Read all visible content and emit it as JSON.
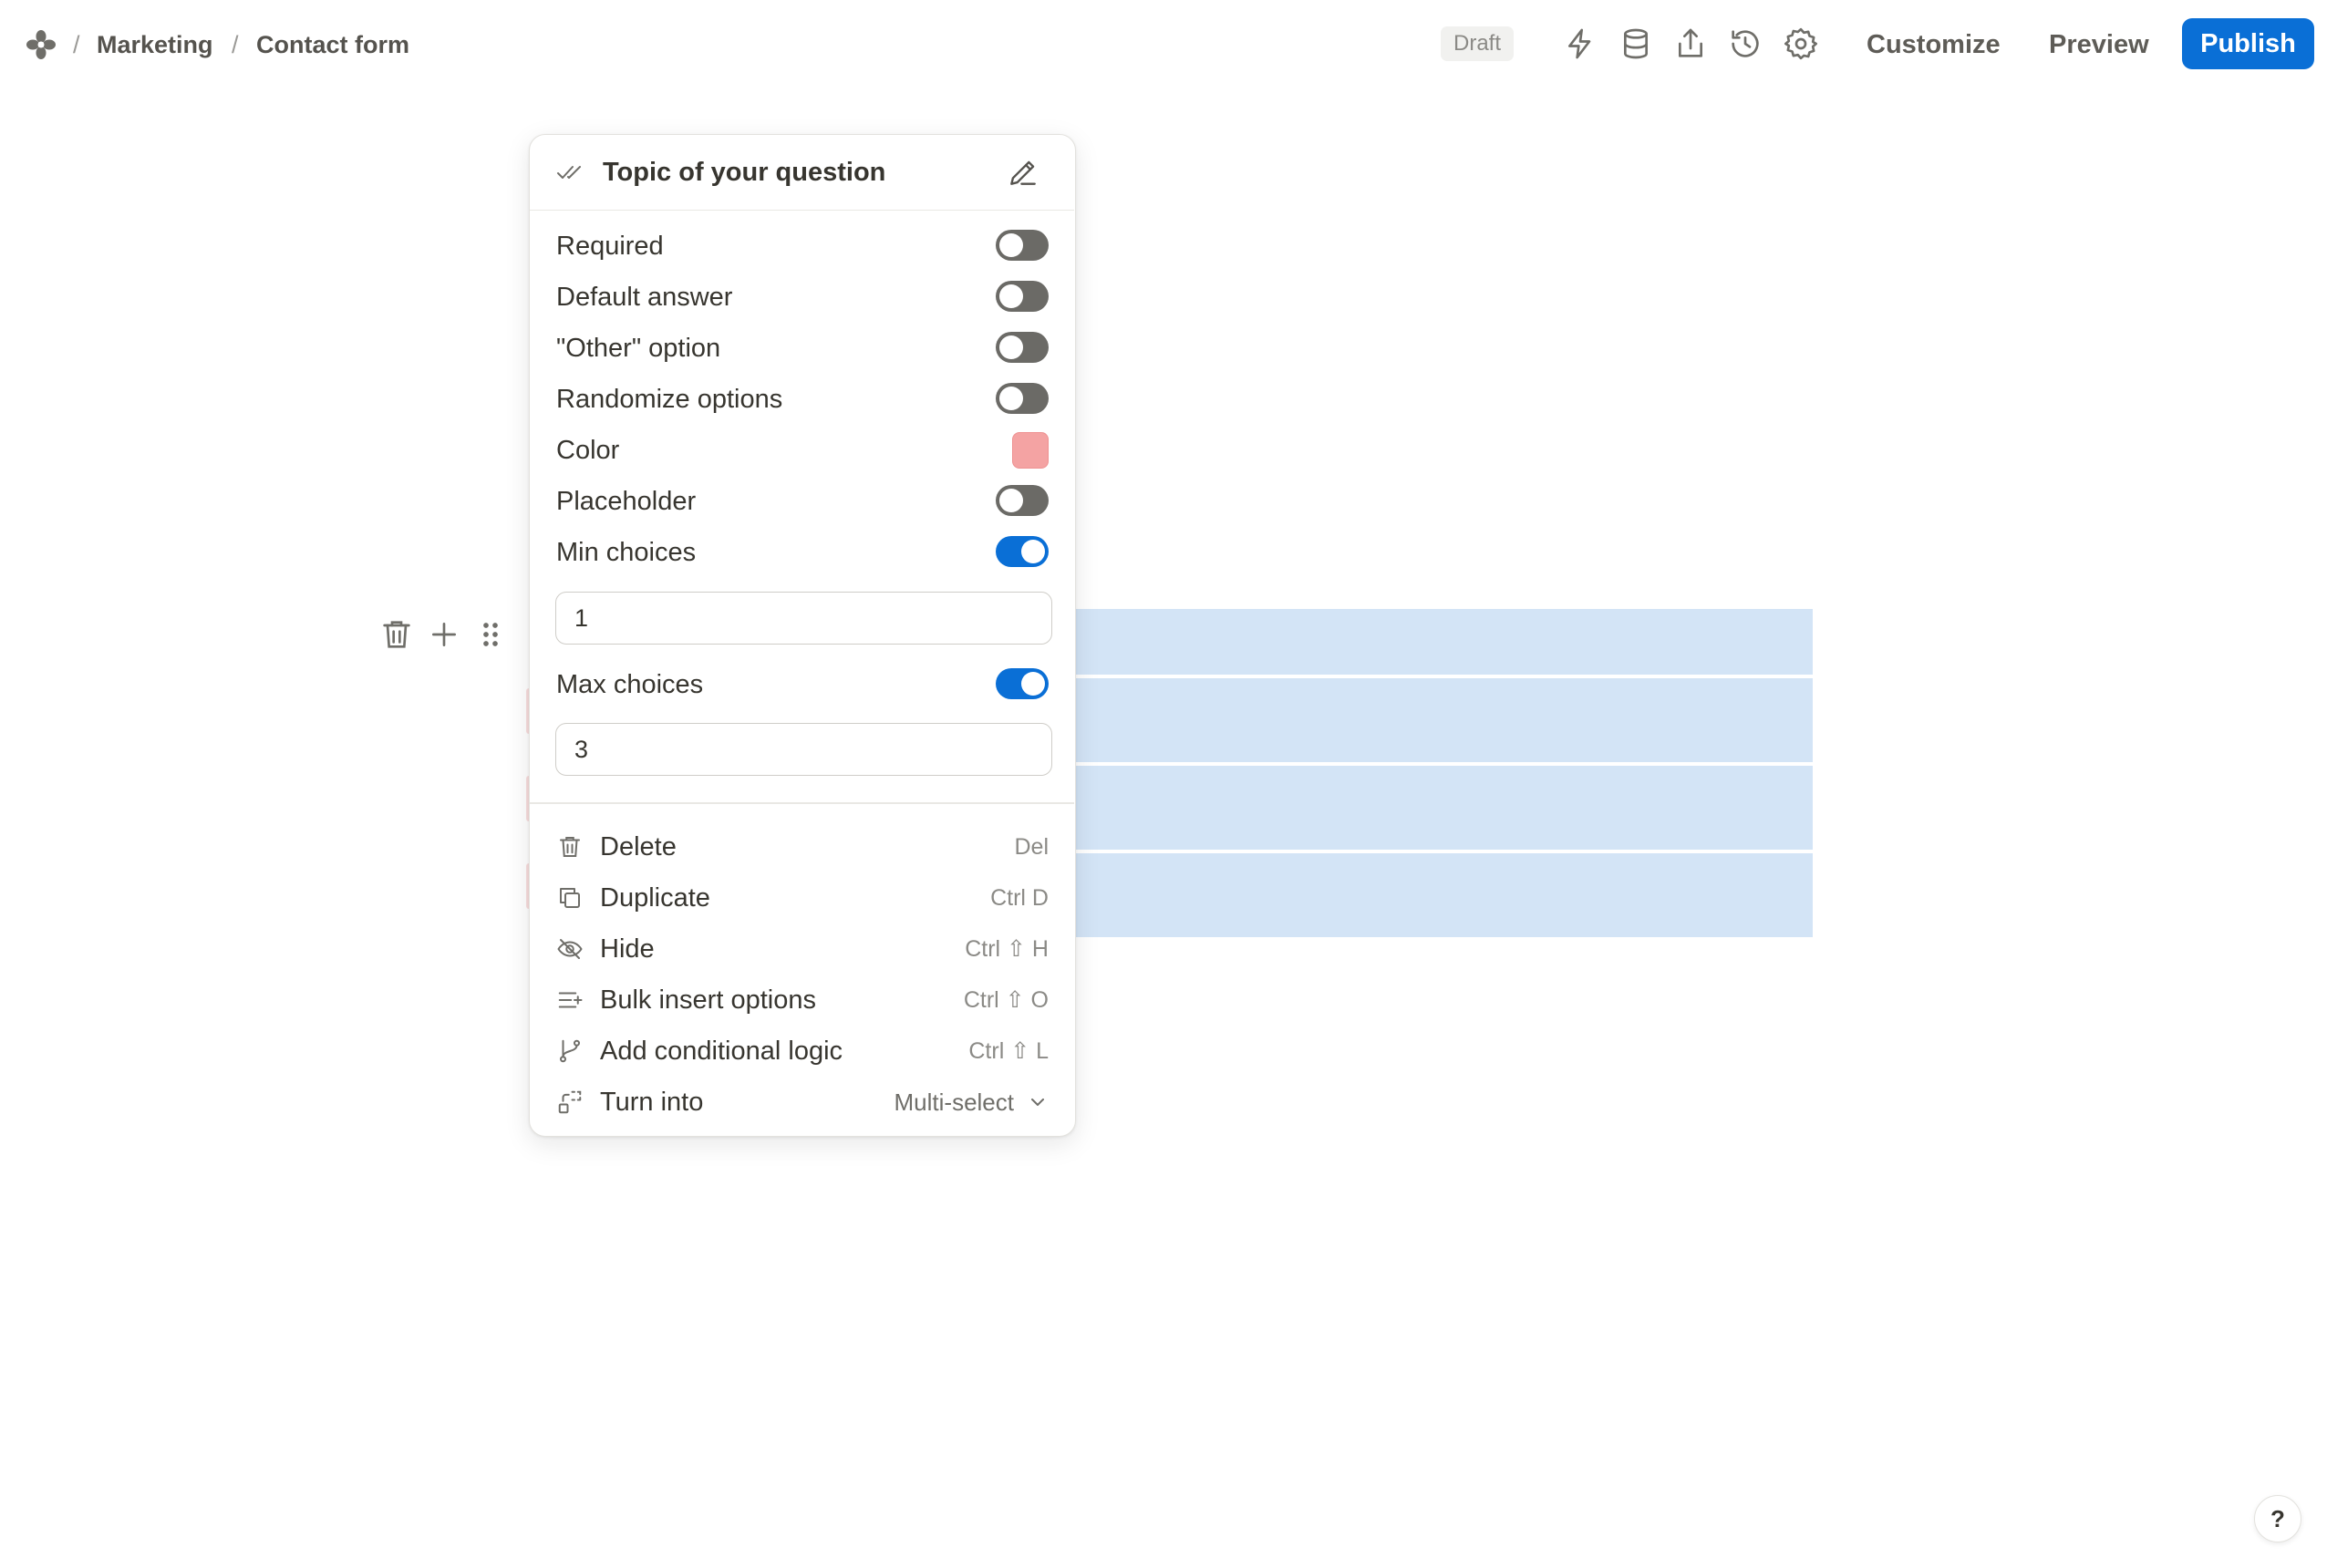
{
  "breadcrumb": {
    "separator": "/",
    "items": [
      "Marketing",
      "Contact form"
    ]
  },
  "header": {
    "status": "Draft",
    "customize_label": "Customize",
    "preview_label": "Preview",
    "publish_label": "Publish",
    "icons": [
      "lightning-icon",
      "database-icon",
      "share-icon",
      "history-icon",
      "gear-icon"
    ]
  },
  "colors": {
    "accent": "#0a6fd6",
    "field_color": "#f4a3a3",
    "selection_highlight": "#d3e4f6"
  },
  "popup": {
    "title": "Topic of your question",
    "options": [
      {
        "label": "Required",
        "type": "toggle",
        "on": false
      },
      {
        "label": "Default answer",
        "type": "toggle",
        "on": false
      },
      {
        "label": "\"Other\" option",
        "type": "toggle",
        "on": false
      },
      {
        "label": "Randomize options",
        "type": "toggle",
        "on": false
      },
      {
        "label": "Color",
        "type": "color",
        "value": "#f4a3a3"
      },
      {
        "label": "Placeholder",
        "type": "toggle",
        "on": false
      },
      {
        "label": "Min choices",
        "type": "toggle",
        "on": true
      },
      {
        "label": "Max choices",
        "type": "toggle",
        "on": true
      }
    ],
    "min_choices_value": "1",
    "max_choices_value": "3",
    "menu": [
      {
        "label": "Delete",
        "shortcut": "Del",
        "icon": "trash-icon"
      },
      {
        "label": "Duplicate",
        "shortcut": "Ctrl D",
        "icon": "duplicate-icon"
      },
      {
        "label": "Hide",
        "shortcut": "Ctrl ⇧ H",
        "icon": "eye-off-icon"
      },
      {
        "label": "Bulk insert options",
        "shortcut": "Ctrl ⇧ O",
        "icon": "bulk-insert-icon"
      },
      {
        "label": "Add conditional logic",
        "shortcut": "Ctrl ⇧ L",
        "icon": "branch-icon"
      },
      {
        "label": "Turn into",
        "value": "Multi-select",
        "icon": "turn-into-icon"
      }
    ]
  },
  "help": {
    "label": "?"
  }
}
